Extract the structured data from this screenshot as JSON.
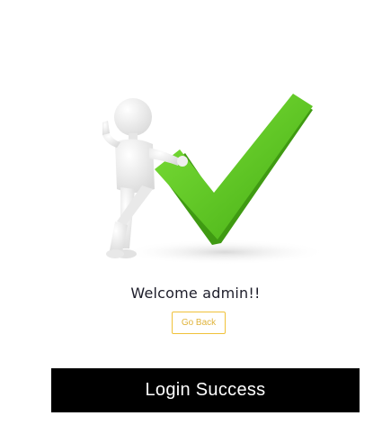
{
  "hero_image": {
    "icon": "man-leaning-on-checkmark-icon",
    "check_color": "#5cc524",
    "check_shadow": "#3f9a12",
    "figure_color": "#f4f4f4"
  },
  "welcome_text": "Welcome admin!!",
  "go_back_label": "Go Back",
  "banner_text": "Login Success",
  "colors": {
    "button_border": "#f0c23a",
    "button_text": "#e0b43c",
    "banner_bg": "#000000",
    "banner_text": "#ffffff"
  }
}
